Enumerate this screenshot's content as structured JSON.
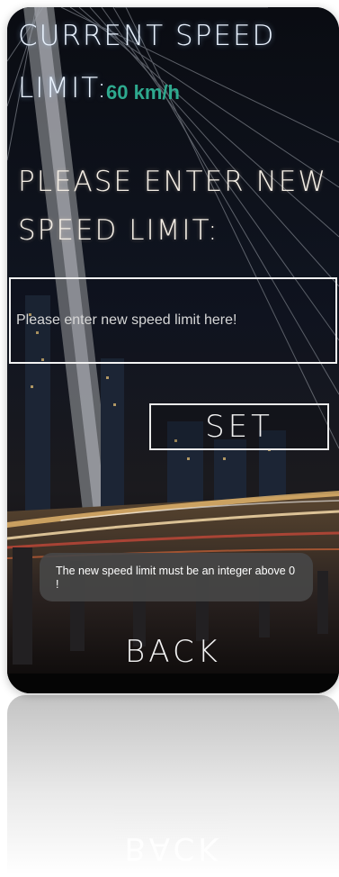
{
  "header": {
    "current_label_line1": "CURRENT SPEED",
    "current_label_line2": "LIMIT:",
    "current_value": "60 km/h"
  },
  "prompt": {
    "line1": "PLEASE ENTER NEW",
    "line2": "SPEED LIMIT:"
  },
  "input": {
    "placeholder": "Please enter new speed limit here!",
    "value": ""
  },
  "buttons": {
    "set": "SET",
    "back": "BACK"
  },
  "toast": {
    "message": "The new speed limit must be an integer above 0 !"
  },
  "colors": {
    "accent": "#2ea98e",
    "title_glow": "#aad2ff",
    "toast_bg": "#464646"
  }
}
